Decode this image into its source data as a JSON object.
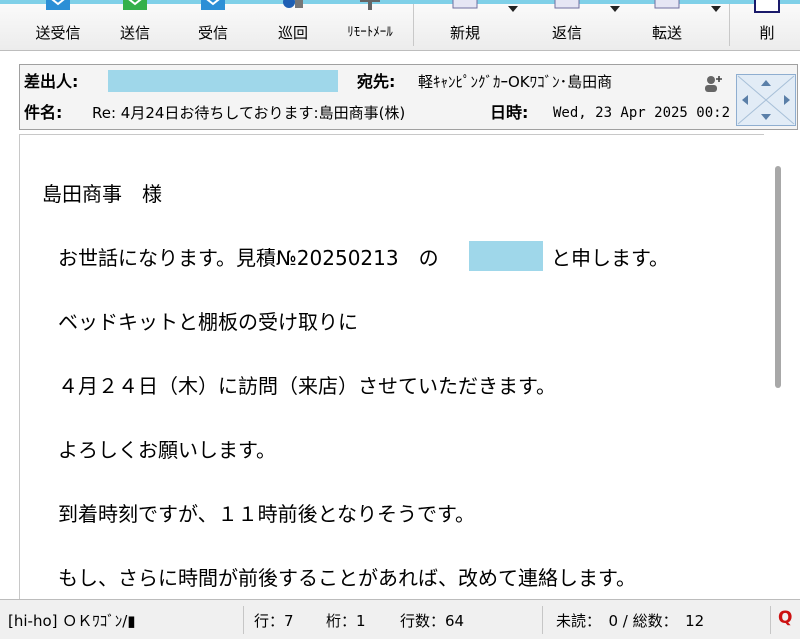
{
  "toolbar": {
    "buttons": [
      {
        "label": "送受信",
        "icon": "send-receive-icon"
      },
      {
        "label": "送信",
        "icon": "send-icon"
      },
      {
        "label": "受信",
        "icon": "receive-icon"
      },
      {
        "label": "巡回",
        "icon": "patrol-icon"
      },
      {
        "label": "ﾘﾓｰﾄﾒｰﾙ",
        "icon": "remote-mail-icon"
      },
      {
        "label": "新規",
        "icon": "new-mail-icon"
      },
      {
        "label": "返信",
        "icon": "reply-icon"
      },
      {
        "label": "転送",
        "icon": "forward-icon"
      },
      {
        "label": "削",
        "icon": "delete-icon"
      }
    ]
  },
  "header": {
    "from_label": "差出人:",
    "to_label": "宛先:",
    "to_value": "軽ｷｬﾝﾋﾟﾝｸﾞｶｰOKﾜｺﾞﾝ･島田商",
    "subject_label": "件名:",
    "subject_value": "Re: 4月24日お待ちしております:島田商事(株)",
    "date_label": "日時:",
    "date_value": "Wed, 23 Apr 2025 00:2"
  },
  "message": {
    "salutation": "島田商事　様",
    "greeting_before": "お世話になります。見積№20250213　の",
    "greeting_after": "と申します。",
    "line_bed_kit": "ベッドキットと棚板の受け取りに",
    "line_visit": "４月２４日（木）に訪問（来店）させていただきます。",
    "line_regards": "よろしくお願いします。",
    "line_arrival": "到着時刻ですが、１１時前後となりそうです。",
    "line_contact": "もし、さらに時間が前後することがあれば、改めて連絡します。"
  },
  "status": {
    "account": "[hi-ho] ＯＫﾜｺﾞﾝ/▮",
    "row": "行：7",
    "col": "桁：1",
    "lines": "行数：64",
    "unread": "未読：　0 / 総数：　12",
    "q": "Q"
  }
}
